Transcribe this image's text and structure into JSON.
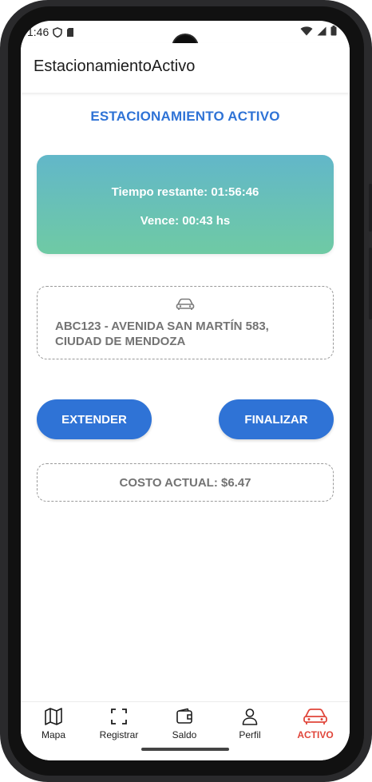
{
  "status_bar": {
    "time": "1:46"
  },
  "app_bar": {
    "title": "EstacionamientoActivo"
  },
  "page": {
    "heading": "ESTACIONAMIENTO ACTIVO",
    "timer": {
      "remaining": "Tiempo restante: 01:56:46",
      "expires": "Vence: 00:43 hs"
    },
    "vehicle": {
      "icon": "car-icon",
      "description": "ABC123 - AVENIDA SAN MARTÍN 583, CIUDAD DE MENDOZA"
    },
    "buttons": {
      "extend_label": "EXTENDER",
      "finish_label": "FINALIZAR"
    },
    "cost": "COSTO ACTUAL: $6.47"
  },
  "bottom_nav": {
    "items": [
      {
        "label": "Mapa",
        "icon": "map-icon",
        "active": false
      },
      {
        "label": "Registrar",
        "icon": "scan-icon",
        "active": false
      },
      {
        "label": "Saldo",
        "icon": "wallet-icon",
        "active": false
      },
      {
        "label": "Perfil",
        "icon": "person-icon",
        "active": false
      },
      {
        "label": "ACTIVO",
        "icon": "car-icon",
        "active": true
      }
    ]
  },
  "colors": {
    "accent": "#2f73d6",
    "active_nav": "#e0453a",
    "card_gradient_top": "#62b7c9",
    "card_gradient_bottom": "#6fcaa4"
  }
}
